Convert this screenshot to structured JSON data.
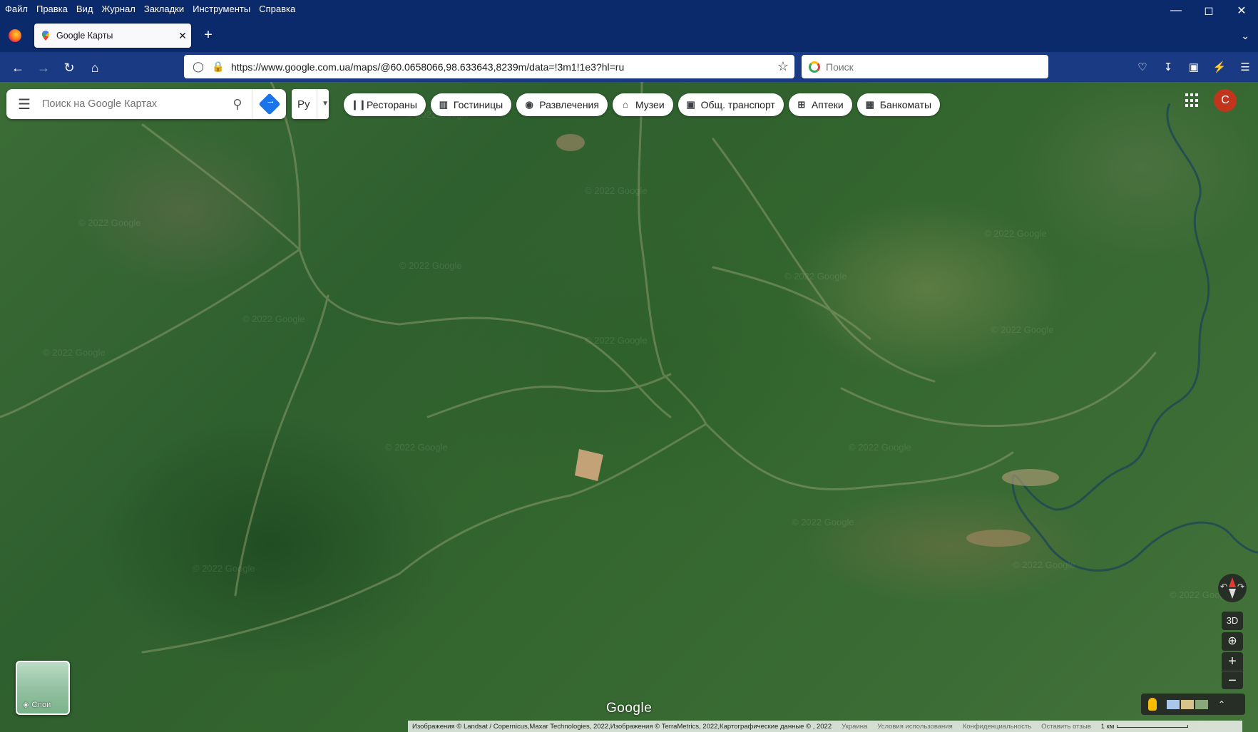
{
  "menubar": {
    "items": [
      "Файл",
      "Правка",
      "Вид",
      "Журнал",
      "Закладки",
      "Инструменты",
      "Справка"
    ]
  },
  "tab": {
    "title": "Google Карты"
  },
  "navbar": {
    "url": "https://www.google.com.ua/maps/@60.0658066,98.633643,8239m/data=!3m1!1e3?hl=ru",
    "search_placeholder": "Поиск"
  },
  "maps": {
    "search_placeholder": "Поиск на Google Картах",
    "language": "Ру",
    "chips": [
      {
        "icon": "utensils-icon",
        "label": "Рестораны"
      },
      {
        "icon": "bed-icon",
        "label": "Гостиницы"
      },
      {
        "icon": "camera-icon",
        "label": "Развлечения"
      },
      {
        "icon": "museum-icon",
        "label": "Музеи"
      },
      {
        "icon": "bus-icon",
        "label": "Общ. транспорт"
      },
      {
        "icon": "pharmacy-icon",
        "label": "Аптеки"
      },
      {
        "icon": "atm-icon",
        "label": "Банкоматы"
      }
    ],
    "avatar_letter": "С",
    "layers_label": "Слои",
    "btn_3d": "3D",
    "zoom_in": "+",
    "zoom_out": "−",
    "logo": "Google",
    "watermark": "© 2022 Google"
  },
  "footer": {
    "attribution": "Изображения © Landsat / Copernicus,Maxar Technologies, 2022,Изображения © TerraMetrics, 2022,Картографические данные © , 2022",
    "country": "Украина",
    "terms": "Условия использования",
    "privacy": "Конфиденциальность",
    "feedback": "Оставить отзыв",
    "scale": "1 км"
  },
  "colors": {
    "window_chrome": "#0b2a6b",
    "avatar": "#c1351d",
    "directions": "#1a73e8"
  }
}
